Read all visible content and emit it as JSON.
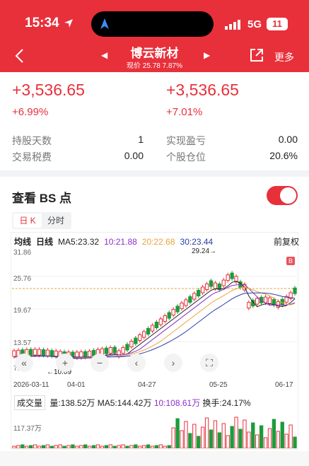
{
  "status": {
    "time": "15:34",
    "network": "5G",
    "battery": "11"
  },
  "header": {
    "stock_name": "博云新材",
    "sub": "现价 25.78 7.87%",
    "more": "更多"
  },
  "summary": {
    "left_amount": "+3,536.65",
    "left_pct": "+6.99%",
    "right_amount": "+3,536.65",
    "right_pct": "+7.01%",
    "rows": [
      {
        "l_label": "持股天数",
        "l_value": "1",
        "r_label": "实现盈亏",
        "r_value": "0.00"
      },
      {
        "l_label": "交易税费",
        "l_value": "0.00",
        "r_label": "个股仓位",
        "r_value": "20.6%"
      }
    ]
  },
  "bs": {
    "title": "查看 BS 点",
    "tabs": [
      "日 K",
      "分时"
    ]
  },
  "kline": {
    "type_label": "均线",
    "period": "日线",
    "ma5": "MA5:23.32",
    "ma10": "10:21.88",
    "ma20": "20:22.68",
    "ma30": "30:23.44",
    "adjust": "前复权",
    "price_ticks": [
      "31.86",
      "25.76",
      "19.67",
      "13.57",
      "7.47"
    ],
    "high_mark": "29.24→",
    "low_mark": "←10.09",
    "bs_marker": "B",
    "dates": [
      "2026-03-11",
      "04-01",
      "04-27",
      "05-25",
      "06-17"
    ]
  },
  "volume": {
    "selector": "成交量",
    "vol": "量:138.52万",
    "ma5": "MA5:144.42万",
    "ma10": "10:108.61万",
    "turnover": "换手:24.17%",
    "tick": "117.37万"
  },
  "colors": {
    "up": "#e8303b",
    "down": "#1e9b3c",
    "ma5": "#222222",
    "ma10": "#8b2fc9",
    "ma20": "#e8a33a",
    "ma30": "#2b3ea8"
  }
}
